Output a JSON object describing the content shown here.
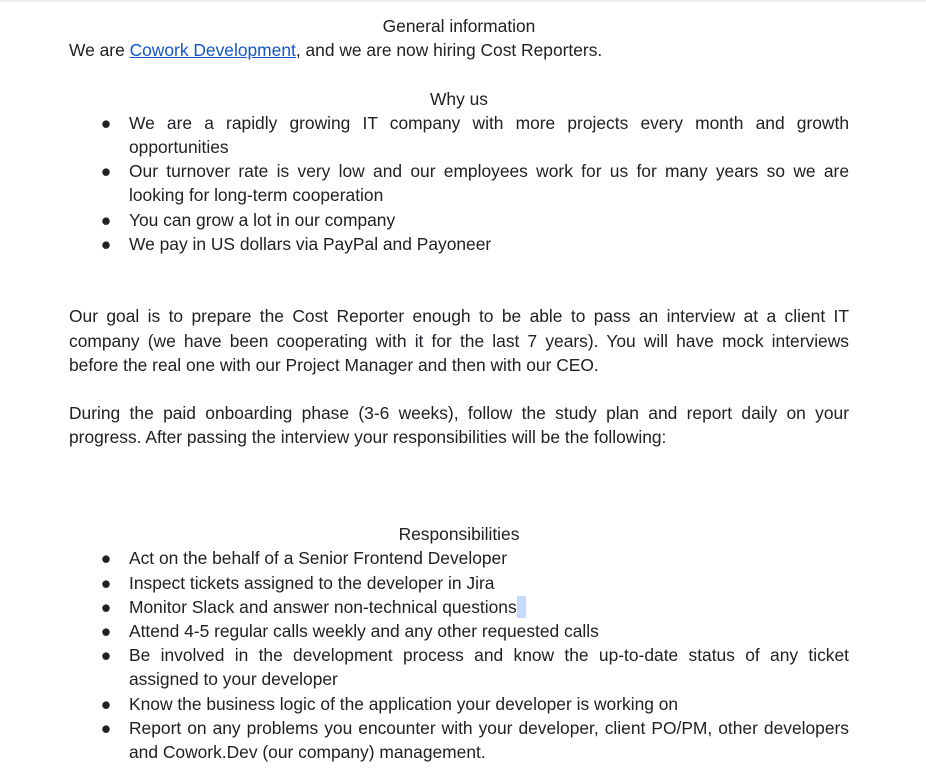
{
  "general": {
    "heading": "General information",
    "intro_prefix": "We are ",
    "company_link": "Cowork Development",
    "intro_suffix": ", and we are now hiring Cost Reporters."
  },
  "why_us": {
    "heading": "Why us",
    "bullet_glyph": "●",
    "items": [
      "We are a rapidly growing IT company with more projects every month and growth opportunities",
      "Our turnover rate is very low and our employees work for us for many years so we are looking for long-term cooperation",
      "You can grow a lot in our company",
      "We pay in US dollars via PayPal and Payoneer"
    ]
  },
  "paragraphs": [
    "Our goal is to prepare the Cost Reporter enough to be able to pass an interview at a client IT company (we have been cooperating with it for the last 7 years). You will have mock interviews before the real one with our Project Manager and then with our CEO.",
    "During the paid onboarding phase (3-6 weeks), follow the study plan and report daily on your progress. After passing the interview your responsibilities will be the following:"
  ],
  "responsibilities": {
    "heading": "Responsibilities",
    "items": [
      "Act on the behalf of a Senior Frontend Developer",
      "Inspect tickets assigned to the developer in Jira",
      "Monitor Slack and answer non-technical questions",
      "Attend 4-5 regular calls weekly and any other requested calls",
      "Be involved in the development process and know the up-to-date status of any ticket assigned to your developer",
      "Know the business logic of the application your developer is working on",
      "Report on any problems you encounter with your developer, client PO/PM, other developers and Cowork.Dev (our company) management."
    ]
  }
}
